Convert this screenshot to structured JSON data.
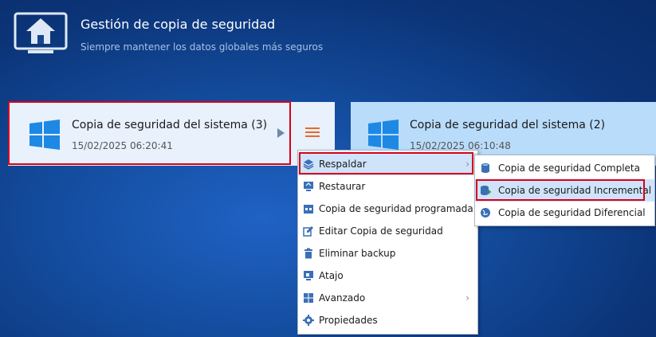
{
  "header": {
    "title": "Gestión de copia de seguridad",
    "subtitle": "Siempre mantener los datos globales más seguros",
    "icon": "home-monitor-icon"
  },
  "cards": [
    {
      "title": "Copia de seguridad del sistema (3)",
      "date": "15/02/2025 06:20:41",
      "icon": "windows-logo-icon",
      "highlighted": true
    },
    {
      "title": "Copia de seguridad del sistema (2)",
      "date": "15/02/2025 06:10:48",
      "icon": "windows-logo-icon",
      "highlighted": false
    }
  ],
  "context_menu": {
    "items": [
      {
        "label": "Respaldar",
        "icon": "layers-icon",
        "has_submenu": true,
        "highlighted": true
      },
      {
        "label": "Restaurar",
        "icon": "restore-monitor-icon"
      },
      {
        "label": "Copia de seguridad programada",
        "icon": "calendar-icon"
      },
      {
        "label": "Editar Copia de seguridad",
        "icon": "edit-icon"
      },
      {
        "label": "Eliminar backup",
        "icon": "trash-icon"
      },
      {
        "label": "Atajo",
        "icon": "shortcut-icon"
      },
      {
        "label": "Avanzado",
        "icon": "grid-icon",
        "has_submenu": true
      },
      {
        "label": "Propiedades",
        "icon": "gear-icon"
      }
    ]
  },
  "submenu": {
    "items": [
      {
        "label": "Copia de seguridad Completa",
        "icon": "database-icon"
      },
      {
        "label": "Copia de seguridad Incremental",
        "icon": "database-plus-icon",
        "highlighted": true
      },
      {
        "label": "Copia de seguridad Diferencial",
        "icon": "globe-icon"
      }
    ]
  },
  "colors": {
    "accent_red": "#d9001b",
    "windows_blue": "#1e88e5",
    "menu_highlight": "#cfe4fb"
  }
}
